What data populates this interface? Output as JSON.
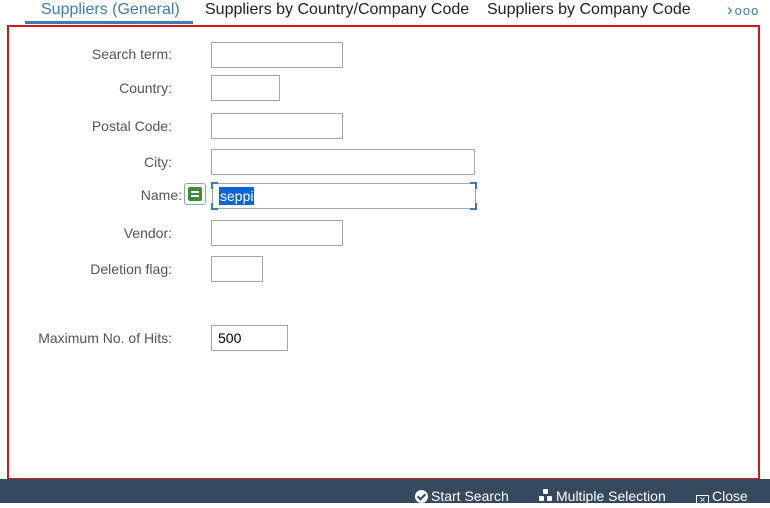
{
  "tabs": [
    {
      "label": "Suppliers (General)",
      "active": true
    },
    {
      "label": "Suppliers by Country/Company Code",
      "active": false
    },
    {
      "label": "Suppliers by Company Code",
      "active": false
    }
  ],
  "tab_more": {
    "chevron": "›",
    "dots": "ooo"
  },
  "form": {
    "search_term": {
      "label": "Search term:",
      "value": ""
    },
    "country": {
      "label": "Country:",
      "value": ""
    },
    "postal_code": {
      "label": "Postal Code:",
      "value": ""
    },
    "city": {
      "label": "City:",
      "value": ""
    },
    "name": {
      "label": "Name:",
      "value": "seppi",
      "operator_icon": "equals-icon"
    },
    "vendor": {
      "label": "Vendor:",
      "value": ""
    },
    "deletion_flag": {
      "label": "Deletion flag:",
      "value": ""
    },
    "max_hits": {
      "label": "Maximum No. of Hits:",
      "value": "500"
    }
  },
  "footer": {
    "start_search": "Start Search",
    "multiple_selection": "Multiple Selection",
    "close": "Close"
  },
  "colors": {
    "accent": "#427cac",
    "highlight_border": "#d8151b",
    "footer_bg": "#354a5f"
  }
}
